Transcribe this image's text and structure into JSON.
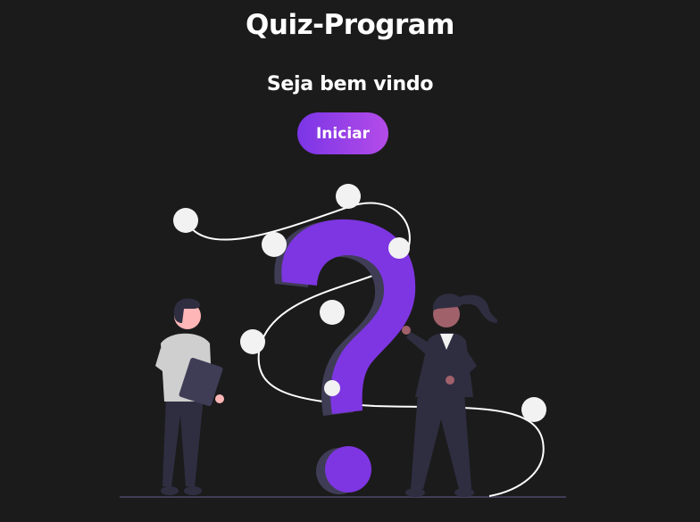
{
  "header": {
    "title": "Quiz-Program"
  },
  "welcome": {
    "message": "Seja bem vindo",
    "start_label": "Iniciar"
  },
  "illustration": {
    "icon": "question-mark-people-illustration",
    "accent_color": "#7e36e2"
  },
  "colors": {
    "background": "#1c1b1c",
    "button_gradient_start": "#7b35e6",
    "button_gradient_end": "#b44ce8",
    "text": "#ffffff"
  }
}
